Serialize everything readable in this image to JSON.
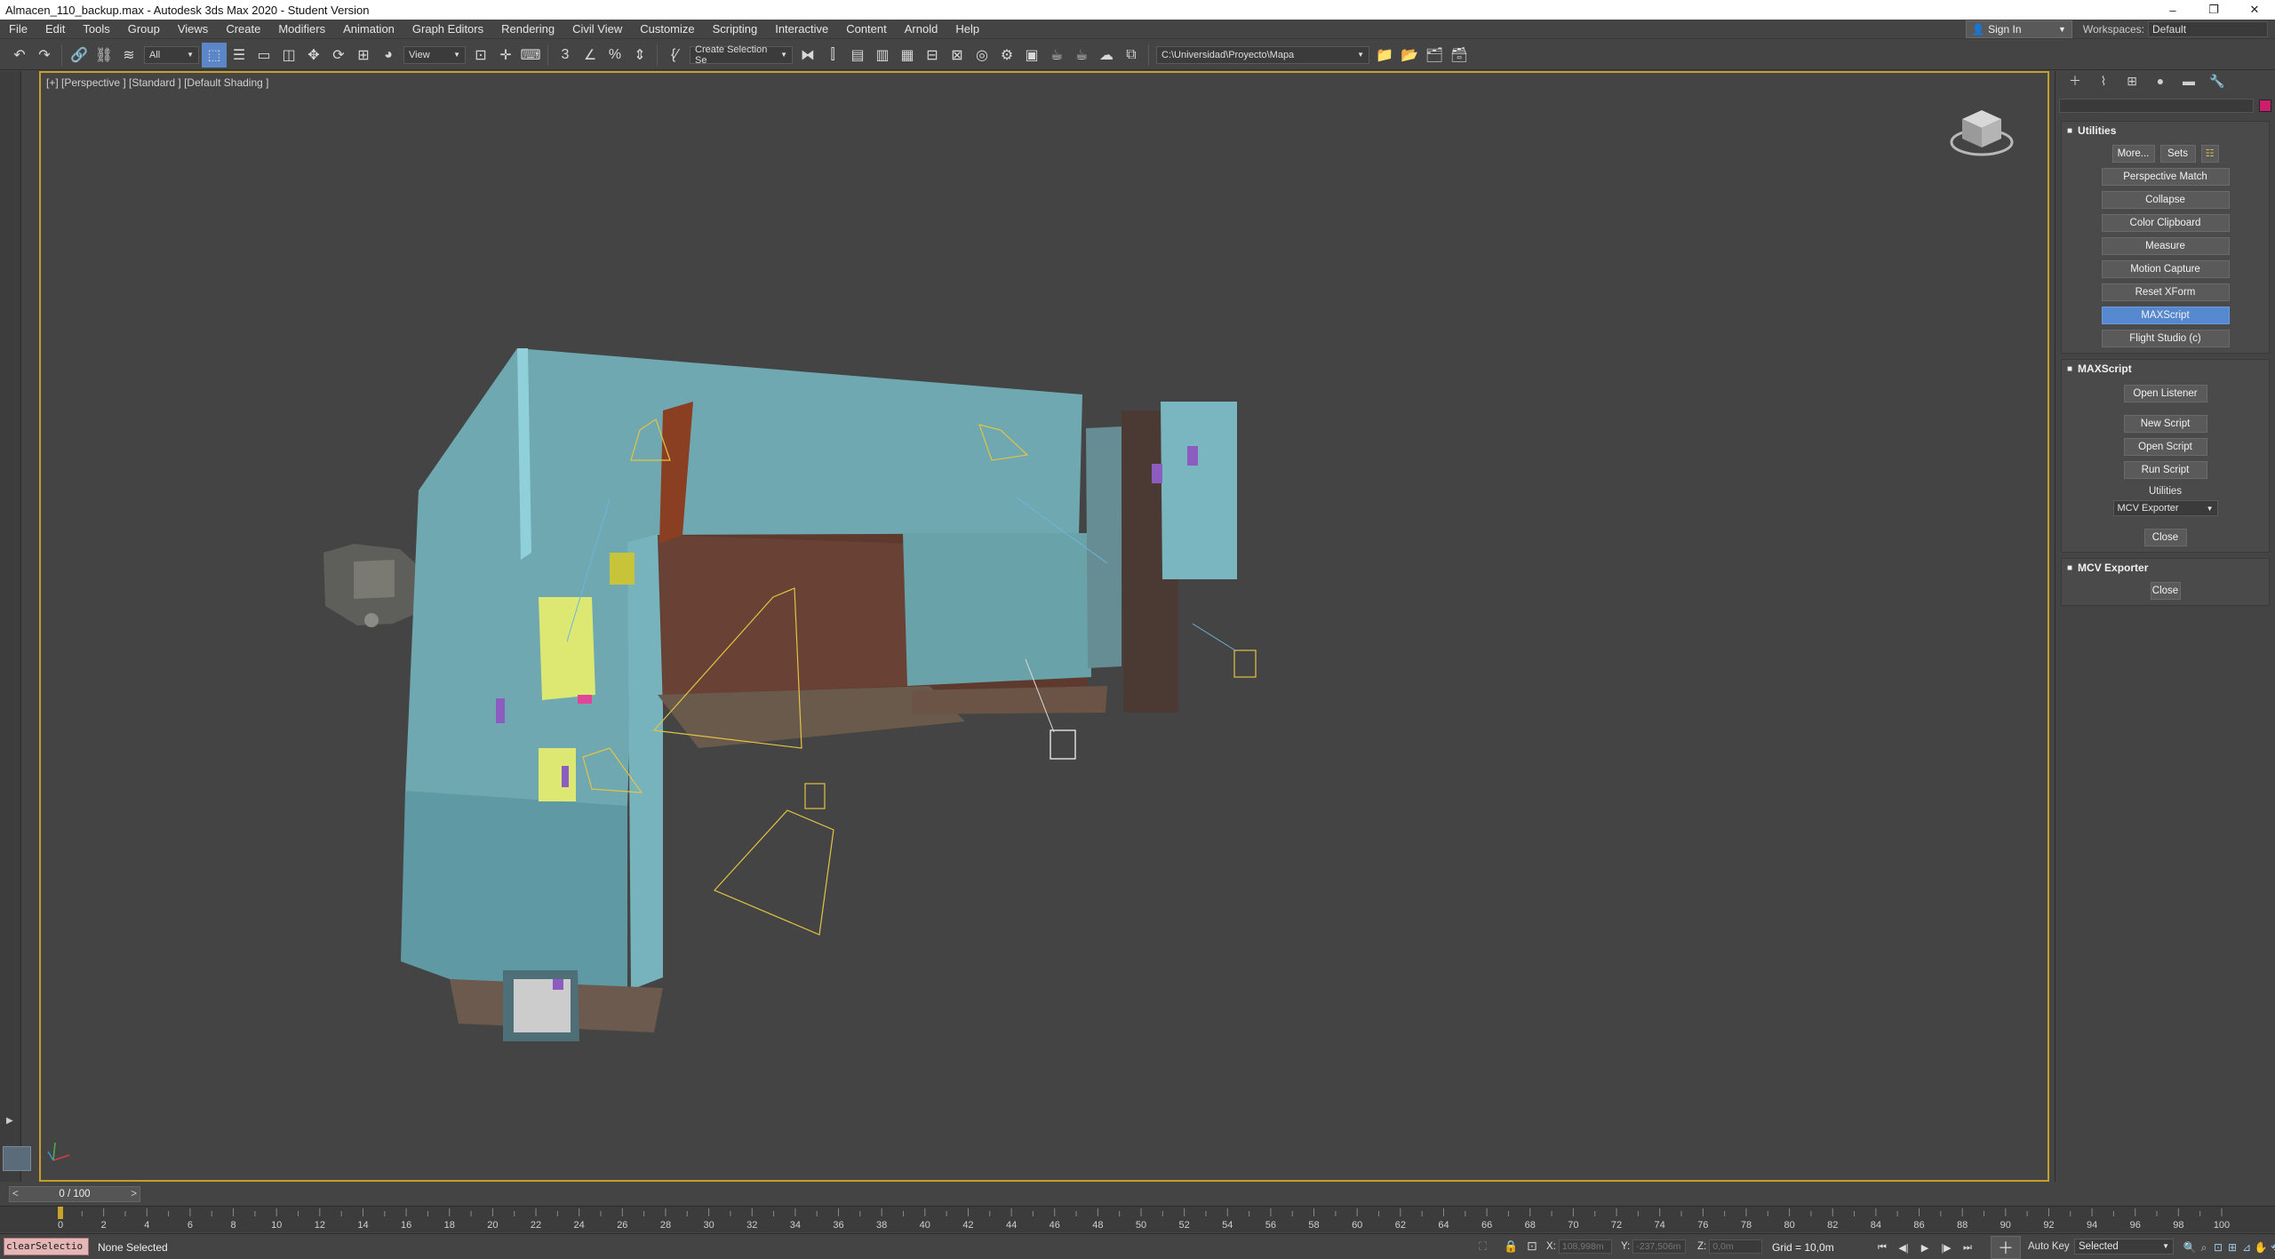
{
  "window": {
    "title": "Almacen_110_backup.max - Autodesk 3ds Max 2020 - Student Version",
    "minimize": "–",
    "restore": "❐",
    "close": "✕"
  },
  "menubar": {
    "items": [
      "File",
      "Edit",
      "Tools",
      "Group",
      "Views",
      "Create",
      "Modifiers",
      "Animation",
      "Graph Editors",
      "Rendering",
      "Civil View",
      "Customize",
      "Scripting",
      "Interactive",
      "Content",
      "Arnold",
      "Help"
    ],
    "sign_in": "Sign In",
    "workspaces_label": "Workspaces:",
    "workspace_value": "Default"
  },
  "toolbar": {
    "selection_filter": "All",
    "ref_coord": "View",
    "named_selection": "Create Selection Se",
    "project_path": "C:\\Universidad\\Proyecto\\Mapa"
  },
  "viewport": {
    "label": "[+] [Perspective ] [Standard ] [Default Shading ]"
  },
  "command_panel": {
    "utilities": {
      "title": "Utilities",
      "more": "More...",
      "sets": "Sets",
      "buttons": [
        "Perspective Match",
        "Collapse",
        "Color Clipboard",
        "Measure",
        "Motion Capture",
        "Reset XForm",
        "MAXScript",
        "Flight Studio (c)"
      ],
      "selected": "MAXScript"
    },
    "maxscript": {
      "title": "MAXScript",
      "open_listener": "Open Listener",
      "new_script": "New Script",
      "open_script": "Open Script",
      "run_script": "Run Script",
      "utilities_label": "Utilities",
      "utility_value": "MCV Exporter",
      "close": "Close"
    },
    "mcv": {
      "title": "MCV Exporter",
      "close": "Close"
    },
    "colors": {
      "object_color": "#cc1f6b",
      "selected_button": "#5688cf"
    }
  },
  "timeline": {
    "frame": "0 / 100",
    "ticks": [
      "0",
      "2",
      "4",
      "6",
      "8",
      "10",
      "12",
      "14",
      "16",
      "18",
      "20",
      "22",
      "24",
      "26",
      "28",
      "30",
      "32",
      "34",
      "36",
      "38",
      "40",
      "42",
      "44",
      "46",
      "48",
      "50",
      "52",
      "54",
      "56",
      "58",
      "60",
      "62",
      "64",
      "66",
      "68",
      "70",
      "72",
      "74",
      "76",
      "78",
      "80",
      "82",
      "84",
      "86",
      "88",
      "90",
      "92",
      "94",
      "96",
      "98",
      "100"
    ]
  },
  "status": {
    "maxscript_mini": "clearSelectio",
    "selection": "None Selected",
    "x_label": "X:",
    "x_value": "108,998m",
    "y_label": "Y:",
    "y_value": "-237,506m",
    "z_label": "Z:",
    "z_value": "0,0m",
    "grid": "Grid = 10,0m",
    "auto_key": "Auto Key",
    "key_filter": "Selected"
  }
}
